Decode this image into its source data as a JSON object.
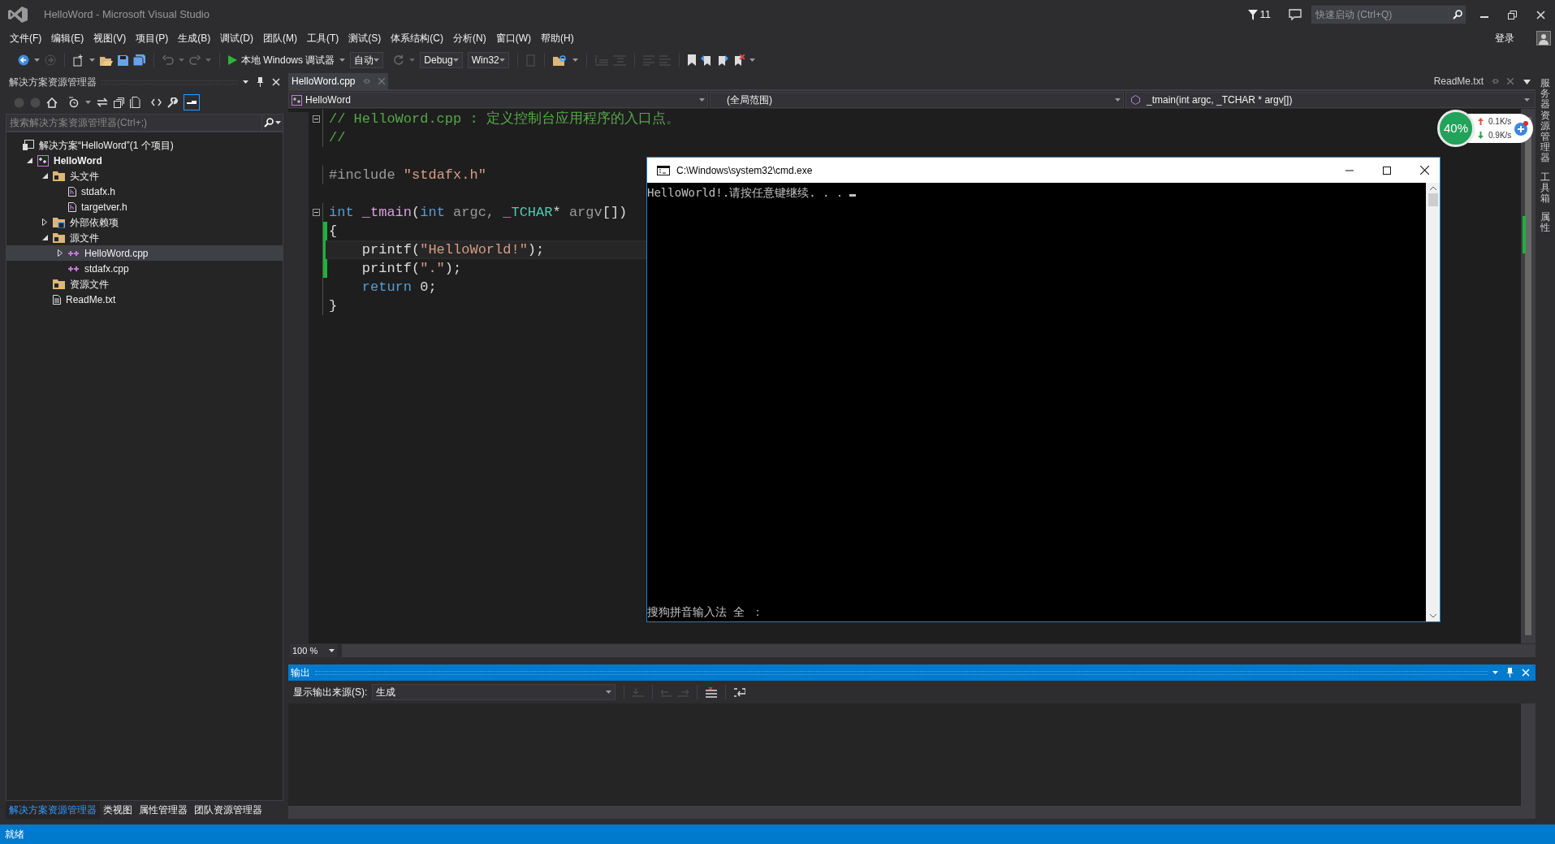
{
  "window": {
    "title": "HelloWord - Microsoft Visual Studio",
    "notifications": "11",
    "quick_launch": {
      "placeholder": "快速启动 (Ctrl+Q)"
    },
    "sign_in": "登录"
  },
  "menu": [
    "文件(F)",
    "编辑(E)",
    "视图(V)",
    "项目(P)",
    "生成(B)",
    "调试(D)",
    "团队(M)",
    "工具(T)",
    "测试(S)",
    "体系结构(C)",
    "分析(N)",
    "窗口(W)",
    "帮助(H)"
  ],
  "toolbar": {
    "debugger": "本地 Windows 调试器",
    "dropdowns": [
      {
        "value": "自动"
      },
      {
        "value": "Debug"
      },
      {
        "value": "Win32"
      }
    ]
  },
  "solution_explorer": {
    "title": "解决方案资源管理器",
    "search": {
      "placeholder": "搜索解决方案资源管理器(Ctrl+;)"
    },
    "tree": [
      {
        "label": "解决方案“HelloWord”(1 个项目)",
        "kind": "solution",
        "selected": false,
        "children": [
          {
            "label": "HelloWord",
            "kind": "project",
            "selected": false,
            "expanded": true,
            "children": [
              {
                "label": "头文件",
                "kind": "folder",
                "selected": false,
                "expanded": true,
                "children": [
                  {
                    "label": "stdafx.h",
                    "kind": "header",
                    "selected": false
                  },
                  {
                    "label": "targetver.h",
                    "kind": "header",
                    "selected": false
                  }
                ]
              },
              {
                "label": "外部依赖项",
                "kind": "references",
                "selected": false,
                "expanded": false
              },
              {
                "label": "源文件",
                "kind": "folder",
                "selected": false,
                "expanded": true,
                "children": [
                  {
                    "label": "HelloWord.cpp",
                    "kind": "cpp",
                    "selected": true,
                    "expanded": false
                  },
                  {
                    "label": "stdafx.cpp",
                    "kind": "cpp",
                    "selected": false
                  }
                ]
              },
              {
                "label": "资源文件",
                "kind": "folder",
                "selected": false
              },
              {
                "label": "ReadMe.txt",
                "kind": "text",
                "selected": false
              }
            ]
          }
        ]
      }
    ],
    "bottom_tabs": [
      {
        "label": "解决方案资源管理器",
        "selected": true
      },
      {
        "label": "类视图",
        "selected": false
      },
      {
        "label": "属性管理器",
        "selected": false
      },
      {
        "label": "团队资源管理器",
        "selected": false
      }
    ]
  },
  "editor": {
    "tabs": [
      {
        "label": "HelloWord.cpp",
        "selected": true
      },
      {
        "label": "ReadMe.txt",
        "selected": false
      }
    ],
    "nav": [
      "HelloWord",
      "(全局范围)",
      "_tmain(int argc, _TCHAR * argv[])"
    ],
    "lines": [
      {
        "kind": "code",
        "fold": true,
        "changed": false,
        "current": false,
        "tokens": [
          {
            "kind": "comment",
            "text": "// HelloWord.cpp : 定义控制台应用程序的入口点。"
          }
        ]
      },
      {
        "kind": "code",
        "fold": false,
        "changed": false,
        "current": false,
        "tokens": [
          {
            "kind": "comment",
            "text": "//"
          }
        ]
      },
      {
        "kind": "blank"
      },
      {
        "kind": "code",
        "fold": false,
        "changed": false,
        "current": false,
        "tokens": [
          {
            "kind": "preprocessor",
            "text": "#include "
          },
          {
            "kind": "string",
            "text": "\"stdafx.h\""
          }
        ]
      },
      {
        "kind": "blank"
      },
      {
        "kind": "code",
        "fold": true,
        "changed": false,
        "current": false,
        "tokens": [
          {
            "kind": "keyword",
            "text": "int"
          },
          {
            "kind": "function",
            "text": " _tmain"
          },
          {
            "kind": "plain",
            "text": "("
          },
          {
            "kind": "keyword",
            "text": "int"
          },
          {
            "kind": "param",
            "text": " argc, "
          },
          {
            "kind": "type",
            "text": "_TCHAR"
          },
          {
            "kind": "plain",
            "text": "* "
          },
          {
            "kind": "param",
            "text": "argv"
          },
          {
            "kind": "plain",
            "text": "[])"
          }
        ]
      },
      {
        "kind": "code",
        "fold": false,
        "changed": true,
        "current": false,
        "tokens": [
          {
            "kind": "plain",
            "text": "{"
          }
        ]
      },
      {
        "kind": "code",
        "fold": false,
        "changed": true,
        "current": true,
        "tokens": [
          {
            "kind": "plain",
            "text": "    printf("
          },
          {
            "kind": "string",
            "text": "\"HelloWorld!\""
          },
          {
            "kind": "plain",
            "text": ");"
          }
        ]
      },
      {
        "kind": "code",
        "fold": false,
        "changed": true,
        "current": false,
        "tokens": [
          {
            "kind": "plain",
            "text": "    printf("
          },
          {
            "kind": "string",
            "text": "\".\""
          },
          {
            "kind": "plain",
            "text": ");"
          }
        ]
      },
      {
        "kind": "code",
        "fold": false,
        "changed": false,
        "current": false,
        "tokens": [
          {
            "kind": "keyword",
            "text": "    return"
          },
          {
            "kind": "plain",
            "text": " 0;"
          }
        ]
      },
      {
        "kind": "code",
        "fold": false,
        "changed": false,
        "current": false,
        "tokens": [
          {
            "kind": "plain",
            "text": "}"
          }
        ]
      }
    ],
    "zoom": "100 %"
  },
  "output": {
    "title": "输出",
    "source_label": "显示输出来源(S):",
    "source": "生成"
  },
  "side_tabs": [
    "服务器资源管理器",
    "工具箱",
    "属性"
  ],
  "console": {
    "title": "C:\\Windows\\system32\\cmd.exe",
    "lines": [
      "HelloWorld!.请按任意键继续. . ."
    ],
    "ime": "搜狗拼音输入法 全 ："
  },
  "net_widget": {
    "percent": "40%",
    "upload": "0.1K/s",
    "download": "0.9K/s"
  },
  "status_bar": {
    "text": "就绪"
  }
}
